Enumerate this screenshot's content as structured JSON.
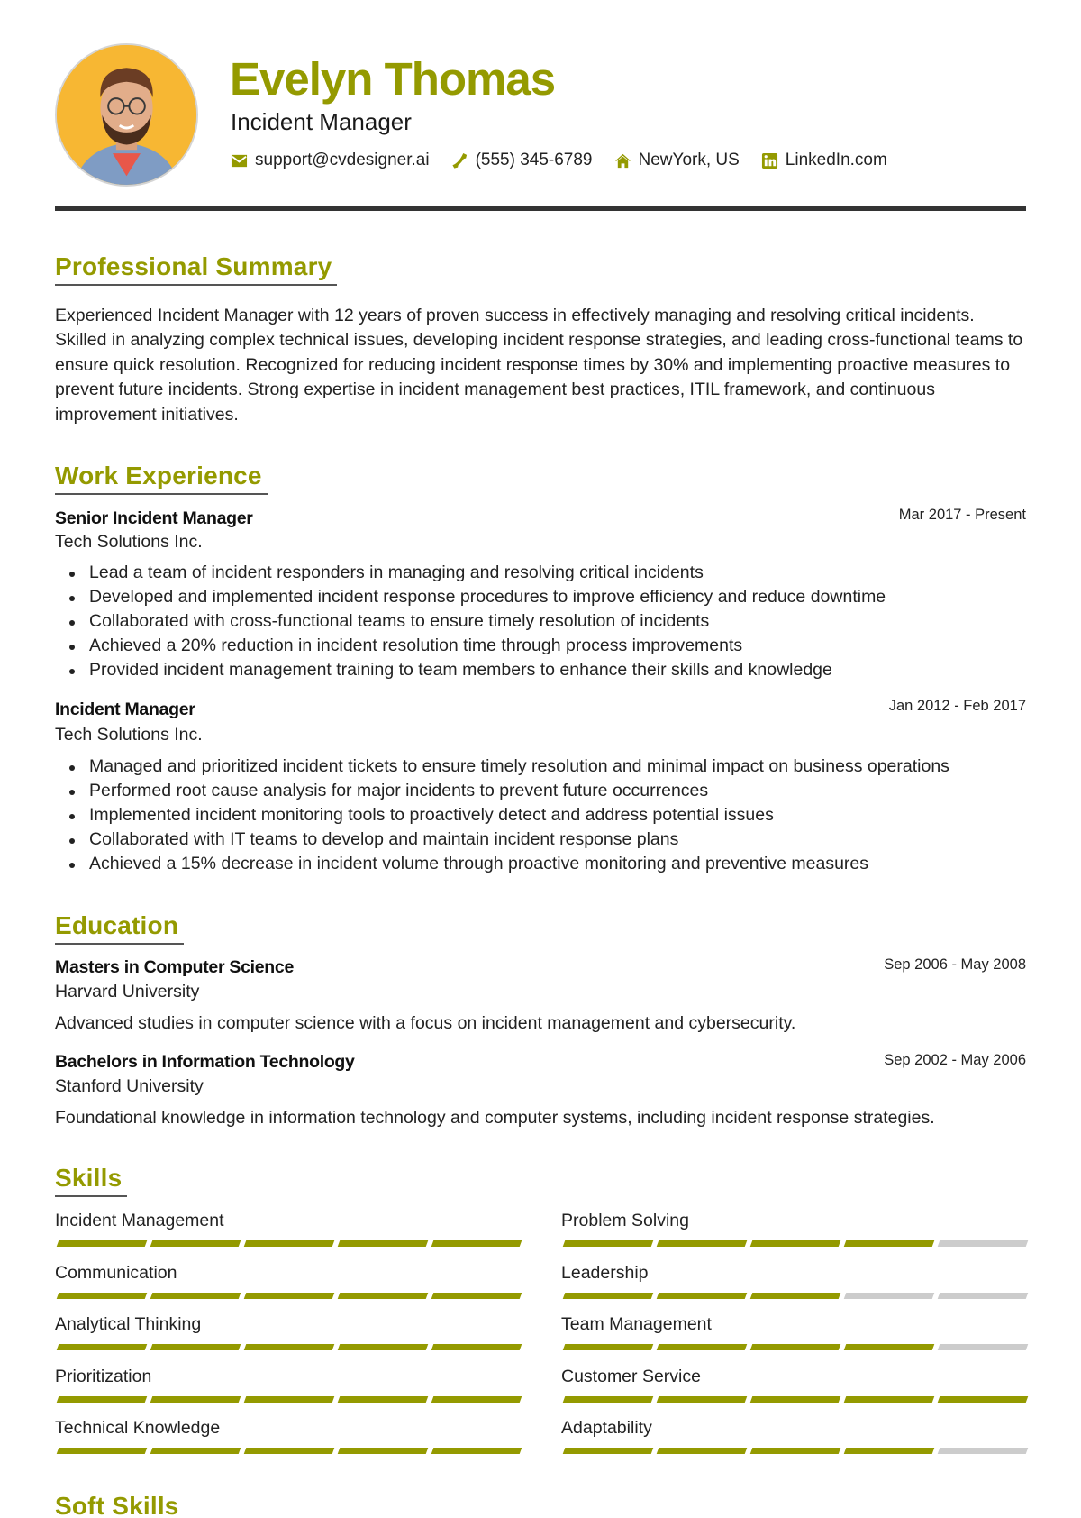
{
  "header": {
    "name": "Evelyn Thomas",
    "title": "Incident Manager",
    "avatar_alt": "profile-photo",
    "contacts": [
      {
        "icon": "envelope-icon",
        "text": "support@cvdesigner.ai"
      },
      {
        "icon": "phone-icon",
        "text": "(555) 345-6789"
      },
      {
        "icon": "home-icon",
        "text": "NewYork, US"
      },
      {
        "icon": "linkedin-icon",
        "text": "LinkedIn.com"
      }
    ]
  },
  "colors": {
    "accent": "#949a00",
    "rule": "#333333",
    "skill_empty": "#cccccc"
  },
  "summary": {
    "heading": "Professional Summary",
    "text": "Experienced Incident Manager with 12 years of proven success in effectively managing and resolving critical incidents. Skilled in analyzing complex technical issues, developing incident response strategies, and leading cross-functional teams to ensure quick resolution. Recognized for reducing incident response times by 30% and implementing proactive measures to prevent future incidents. Strong expertise in incident management best practices, ITIL framework, and continuous improvement initiatives."
  },
  "experience": {
    "heading": "Work Experience",
    "jobs": [
      {
        "title": "Senior Incident Manager",
        "company": "Tech Solutions Inc.",
        "dates": "Mar 2017 - Present",
        "bullets": [
          "Lead a team of incident responders in managing and resolving critical incidents",
          "Developed and implemented incident response procedures to improve efficiency and reduce downtime",
          "Collaborated with cross-functional teams to ensure timely resolution of incidents",
          "Achieved a 20% reduction in incident resolution time through process improvements",
          "Provided incident management training to team members to enhance their skills and knowledge"
        ]
      },
      {
        "title": "Incident Manager",
        "company": "Tech Solutions Inc.",
        "dates": "Jan 2012 - Feb 2017",
        "bullets": [
          "Managed and prioritized incident tickets to ensure timely resolution and minimal impact on business operations",
          "Performed root cause analysis for major incidents to prevent future occurrences",
          "Implemented incident monitoring tools to proactively detect and address potential issues",
          "Collaborated with IT teams to develop and maintain incident response plans",
          "Achieved a 15% decrease in incident volume through proactive monitoring and preventive measures"
        ]
      }
    ]
  },
  "education": {
    "heading": "Education",
    "entries": [
      {
        "degree": "Masters in Computer Science",
        "school": "Harvard University",
        "dates": "Sep 2006 - May 2008",
        "description": "Advanced studies in computer science with a focus on incident management and cybersecurity."
      },
      {
        "degree": "Bachelors in Information Technology",
        "school": "Stanford University",
        "dates": "Sep 2002 - May 2006",
        "description": "Foundational knowledge in information technology and computer systems, including incident response strategies."
      }
    ]
  },
  "skills": {
    "heading": "Skills",
    "max_level": 5,
    "items": [
      {
        "name": "Incident Management",
        "level": 5
      },
      {
        "name": "Problem Solving",
        "level": 4
      },
      {
        "name": "Communication",
        "level": 5
      },
      {
        "name": "Leadership",
        "level": 3
      },
      {
        "name": "Analytical Thinking",
        "level": 5
      },
      {
        "name": "Team Management",
        "level": 4
      },
      {
        "name": "Prioritization",
        "level": 5
      },
      {
        "name": "Customer Service",
        "level": 5
      },
      {
        "name": "Technical Knowledge",
        "level": 5
      },
      {
        "name": "Adaptability",
        "level": 4
      }
    ]
  },
  "soft_skills": {
    "heading": "Soft Skills"
  }
}
